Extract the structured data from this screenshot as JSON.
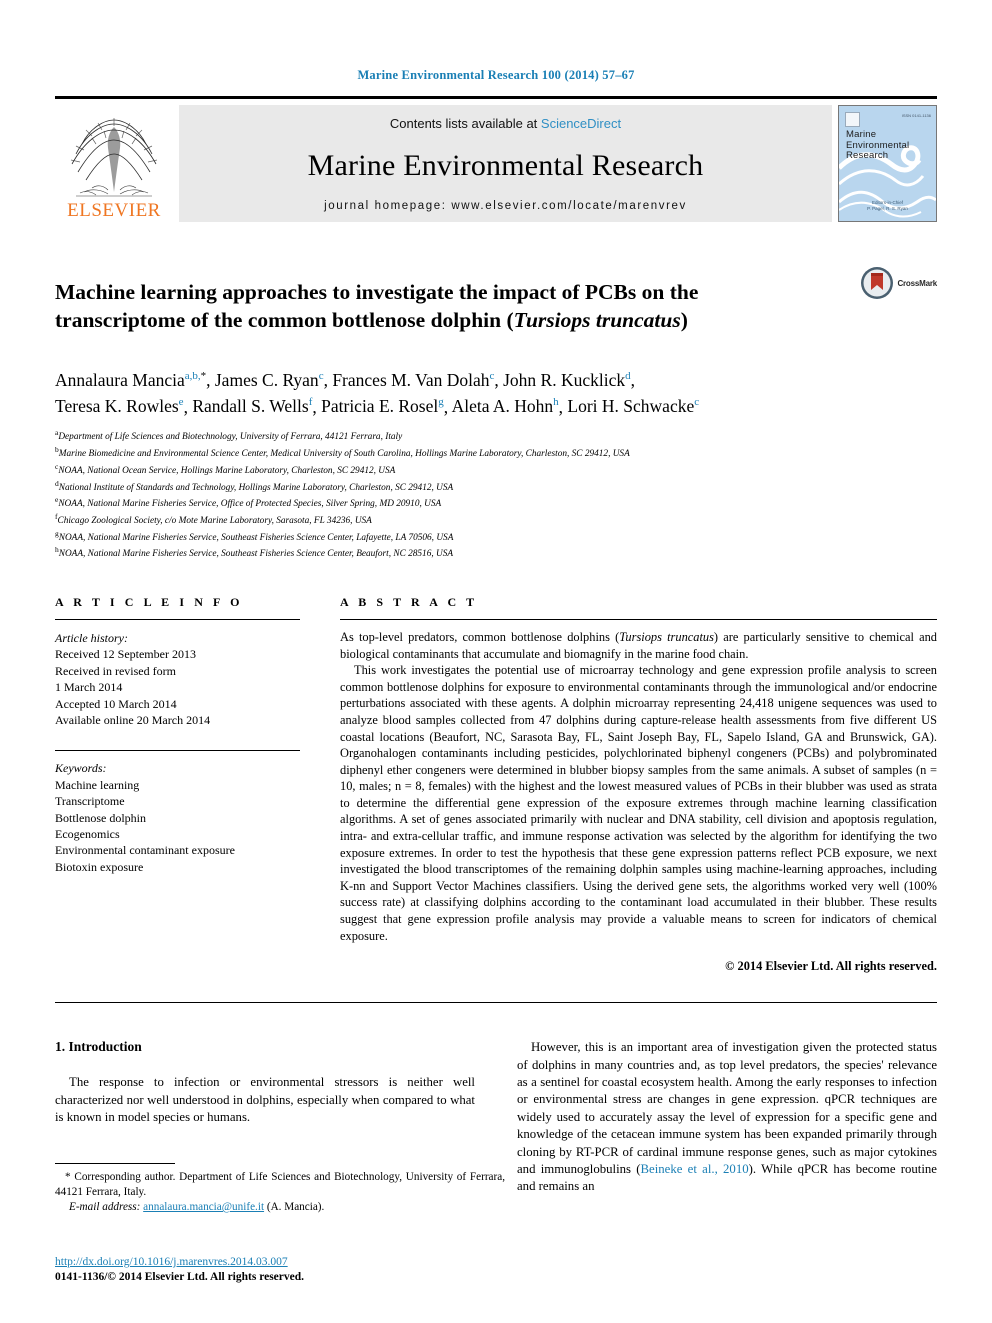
{
  "running_head": "Marine Environmental Research 100 (2014) 57–67",
  "header": {
    "contents_prefix": "Contents lists available at ",
    "sciencedirect": "ScienceDirect",
    "journal_title": "Marine Environmental Research",
    "homepage": "journal homepage: www.elsevier.com/locate/marenvrev",
    "publisher": "ELSEVIER",
    "cover": {
      "line1": "Marine",
      "line2": "Environmental",
      "line3": "Research",
      "footer1": "Editors-in-Chief",
      "footer2": "P. Pagel, R. S. Ryan"
    }
  },
  "title": {
    "line1": "Machine learning approaches to investigate the impact of PCBs on the",
    "line2_pre": "transcriptome of the common bottlenose dolphin (",
    "line2_species": "Tursiops truncatus",
    "line2_post": ")",
    "crossmark_label": "CrossMark"
  },
  "authors": {
    "line1": [
      {
        "name": "Annalaura Mancia",
        "sup": "a,b,",
        "star": "*"
      },
      {
        "name": "James C. Ryan",
        "sup": "c"
      },
      {
        "name": "Frances M. Van Dolah",
        "sup": "c"
      },
      {
        "name": "John R. Kucklick",
        "sup": "d"
      }
    ],
    "line2": [
      {
        "name": "Teresa K. Rowles",
        "sup": "e"
      },
      {
        "name": "Randall S. Wells",
        "sup": "f"
      },
      {
        "name": "Patricia E. Rosel",
        "sup": "g"
      },
      {
        "name": "Aleta A. Hohn",
        "sup": "h"
      },
      {
        "name": "Lori H. Schwacke",
        "sup": "c"
      }
    ]
  },
  "affiliations": [
    {
      "mark": "a",
      "text": "Department of Life Sciences and Biotechnology, University of Ferrara, 44121 Ferrara, Italy"
    },
    {
      "mark": "b",
      "text": "Marine Biomedicine and Environmental Science Center, Medical University of South Carolina, Hollings Marine Laboratory, Charleston, SC 29412, USA"
    },
    {
      "mark": "c",
      "text": "NOAA, National Ocean Service, Hollings Marine Laboratory, Charleston, SC 29412, USA"
    },
    {
      "mark": "d",
      "text": "National Institute of Standards and Technology, Hollings Marine Laboratory, Charleston, SC 29412, USA"
    },
    {
      "mark": "e",
      "text": "NOAA, National Marine Fisheries Service, Office of Protected Species, Silver Spring, MD 20910, USA"
    },
    {
      "mark": "f",
      "text": "Chicago Zoological Society, c/o Mote Marine Laboratory, Sarasota, FL 34236, USA"
    },
    {
      "mark": "g",
      "text": "NOAA, National Marine Fisheries Service, Southeast Fisheries Science Center, Lafayette, LA 70506, USA"
    },
    {
      "mark": "h",
      "text": "NOAA, National Marine Fisheries Service, Southeast Fisheries Science Center, Beaufort, NC 28516, USA"
    }
  ],
  "article_info": {
    "heading": "A R T I C L E   I N F O",
    "history_label": "Article history:",
    "history": [
      "Received 12 September 2013",
      "Received in revised form",
      "1 March 2014",
      "Accepted 10 March 2014",
      "Available online 20 March 2014"
    ],
    "keywords_label": "Keywords:",
    "keywords": [
      "Machine learning",
      "Transcriptome",
      "Bottlenose dolphin",
      "Ecogenomics",
      "Environmental contaminant exposure",
      "Biotoxin exposure"
    ]
  },
  "abstract": {
    "heading": "A B S T R A C T",
    "p1_pre": "As top-level predators, common bottlenose dolphins (",
    "p1_species": "Tursiops truncatus",
    "p1_post": ") are particularly sensitive to chemical and biological contaminants that accumulate and biomagnify in the marine food chain.",
    "p2": "This work investigates the potential use of microarray technology and gene expression profile analysis to screen common bottlenose dolphins for exposure to environmental contaminants through the immunological and/or endocrine perturbations associated with these agents. A dolphin microarray representing 24,418 unigene sequences was used to analyze blood samples collected from 47 dolphins during capture-release health assessments from five different US coastal locations (Beaufort, NC, Sarasota Bay, FL, Saint Joseph Bay, FL, Sapelo Island, GA and Brunswick, GA). Organohalogen contaminants including pesticides, polychlorinated biphenyl congeners (PCBs) and polybrominated diphenyl ether congeners were determined in blubber biopsy samples from the same animals. A subset of samples (n = 10, males; n = 8, females) with the highest and the lowest measured values of PCBs in their blubber was used as strata to determine the differential gene expression of the exposure extremes through machine learning classification algorithms. A set of genes associated primarily with nuclear and DNA stability, cell division and apoptosis regulation, intra- and extra-cellular traffic, and immune response activation was selected by the algorithm for identifying the two exposure extremes. In order to test the hypothesis that these gene expression patterns reflect PCB exposure, we next investigated the blood transcriptomes of the remaining dolphin samples using machine-learning approaches, including K-nn and Support Vector Machines classifiers. Using the derived gene sets, the algorithms worked very well (100% success rate) at classifying dolphins according to the contaminant load accumulated in their blubber. These results suggest that gene expression profile analysis may provide a valuable means to screen for indicators of chemical exposure.",
    "copyright": "© 2014 Elsevier Ltd. All rights reserved."
  },
  "introduction": {
    "heading": "1. Introduction",
    "left_paragraph": "The response to infection or environmental stressors is neither well characterized nor well understood in dolphins, especially when compared to what is known in model species or humans.",
    "right_paragraph_pre": "However, this is an important area of investigation given the protected status of dolphins in many countries and, as top level predators, the species' relevance as a sentinel for coastal ecosystem health. Among the early responses to infection or environmental stress are changes in gene expression. qPCR techniques are widely used to accurately assay the level of expression for a specific gene and knowledge of the cetacean immune system has been expanded primarily through cloning by RT-PCR of cardinal immune response genes, such as major cytokines and immunoglobulins (",
    "right_citation": "Beineke et al., 2010",
    "right_paragraph_post": "). While qPCR has become routine and remains an"
  },
  "footnote": {
    "star": "*",
    "corresponding": "Corresponding author. Department of Life Sciences and Biotechnology, University of Ferrara, 44121 Ferrara, Italy.",
    "email_label": "E-mail address:",
    "email": "annalaura.mancia@unife.it",
    "email_suffix": "(A. Mancia)."
  },
  "footer": {
    "doi": "http://dx.doi.org/10.1016/j.marenvres.2014.03.007",
    "issn": "0141-1136/© 2014 Elsevier Ltd. All rights reserved."
  },
  "colors": {
    "link_blue": "#1a7fb5",
    "elsevier_orange": "#ef7622",
    "cover_blue": "#b9d6ee"
  }
}
